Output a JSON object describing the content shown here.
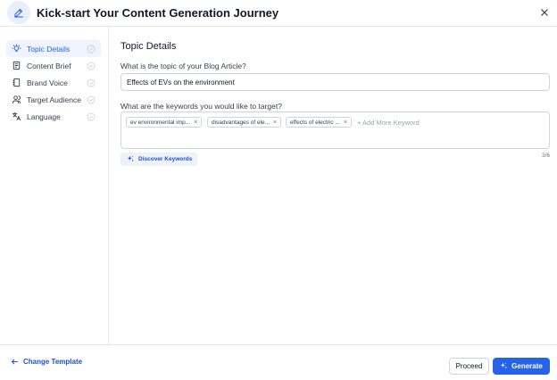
{
  "header": {
    "title": "Kick-start Your Content Generation Journey",
    "icon": "pencil-icon",
    "close_icon": "close-icon"
  },
  "sidebar": {
    "items": [
      {
        "label": "Topic Details",
        "icon": "lightbulb-icon",
        "active": true
      },
      {
        "label": "Content Brief",
        "icon": "document-icon",
        "active": false
      },
      {
        "label": "Brand Voice",
        "icon": "notebook-icon",
        "active": false
      },
      {
        "label": "Target Audience",
        "icon": "users-icon",
        "active": false
      },
      {
        "label": "Language",
        "icon": "translate-icon",
        "active": false
      }
    ]
  },
  "main": {
    "section_title": "Topic Details",
    "topic_label": "What is the topic of your Blog Article?",
    "topic_value": "Effects of EVs on the environment",
    "keywords_label": "What are the keywords you would like to target?",
    "keywords": [
      "ev environmental imp...",
      "disadvantages of ele...",
      "effects of electric ..."
    ],
    "add_keyword": "+ Add More Keyword",
    "discover_label": "Discover Keywords",
    "counter": "3/6"
  },
  "footer": {
    "change_template": "Change Template",
    "proceed": "Proceed",
    "generate": "Generate"
  },
  "colors": {
    "accent": "#2563eb",
    "active_bg": "#eef3fd",
    "border": "#e5e7eb"
  }
}
